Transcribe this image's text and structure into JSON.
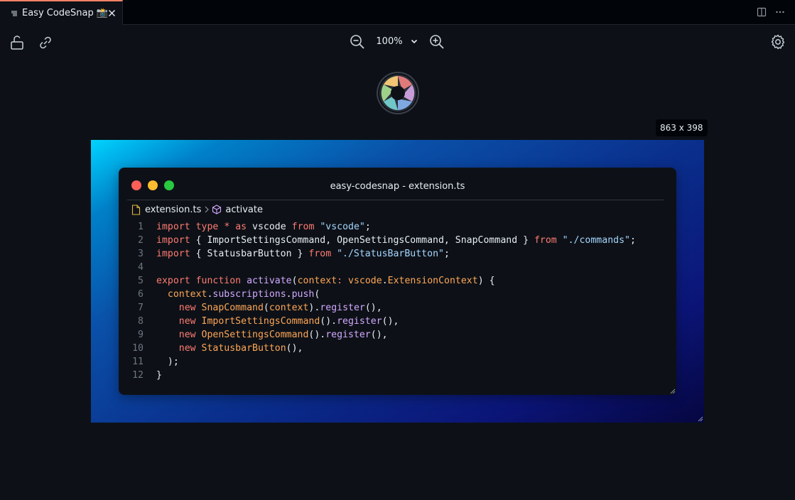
{
  "tab": {
    "label": "Easy CodeSnap 📸",
    "icon": "preview-list-icon",
    "close_icon": "close-icon"
  },
  "tabbar_actions": [
    "split-editor-icon",
    "more-actions-icon"
  ],
  "toolbar": {
    "lock_icon": "unlock-icon",
    "link_icon": "link-icon",
    "zoom_out_icon": "zoom-out-icon",
    "zoom_value": "100%",
    "zoom_in_icon": "zoom-in-icon",
    "settings_icon": "gear-icon"
  },
  "logo": {
    "icon": "camera-shutter-logo"
  },
  "size_badge": "863 x 398",
  "snapshot": {
    "window_title": "easy-codesnap - extension.ts",
    "breadcrumb": {
      "file": "extension.ts",
      "symbol": "activate"
    },
    "traffic_lights": [
      "#ff5f57",
      "#febc2e",
      "#28c840"
    ],
    "code_lines": [
      {
        "n": "1",
        "tokens": [
          [
            "kw",
            "import"
          ],
          [
            "plain",
            " "
          ],
          [
            "kw",
            "type"
          ],
          [
            "plain",
            " "
          ],
          [
            "kw",
            "*"
          ],
          [
            "plain",
            " "
          ],
          [
            "kw",
            "as"
          ],
          [
            "plain",
            " vscode "
          ],
          [
            "kw",
            "from"
          ],
          [
            "plain",
            " "
          ],
          [
            "str",
            "\"vscode\""
          ],
          [
            "punc",
            ";"
          ]
        ]
      },
      {
        "n": "2",
        "tokens": [
          [
            "kw",
            "import"
          ],
          [
            "plain",
            " { ImportSettingsCommand, OpenSettingsCommand, SnapCommand } "
          ],
          [
            "kw",
            "from"
          ],
          [
            "plain",
            " "
          ],
          [
            "str",
            "\"./commands\""
          ],
          [
            "punc",
            ";"
          ]
        ]
      },
      {
        "n": "3",
        "tokens": [
          [
            "kw",
            "import"
          ],
          [
            "plain",
            " { StatusbarButton } "
          ],
          [
            "kw",
            "from"
          ],
          [
            "plain",
            " "
          ],
          [
            "str",
            "\"./StatusBarButton\""
          ],
          [
            "punc",
            ";"
          ]
        ]
      },
      {
        "n": "4",
        "tokens": []
      },
      {
        "n": "5",
        "tokens": [
          [
            "kw",
            "export"
          ],
          [
            "plain",
            " "
          ],
          [
            "kw",
            "function"
          ],
          [
            "plain",
            " "
          ],
          [
            "fn",
            "activate"
          ],
          [
            "punc",
            "("
          ],
          [
            "var",
            "context"
          ],
          [
            "kw",
            ":"
          ],
          [
            "plain",
            " "
          ],
          [
            "cls",
            "vscode"
          ],
          [
            "punc",
            "."
          ],
          [
            "cls",
            "ExtensionContext"
          ],
          [
            "punc",
            ") {"
          ]
        ]
      },
      {
        "n": "6",
        "tokens": [
          [
            "plain",
            "  "
          ],
          [
            "var",
            "context"
          ],
          [
            "punc",
            "."
          ],
          [
            "prop",
            "subscriptions"
          ],
          [
            "punc",
            "."
          ],
          [
            "fn",
            "push"
          ],
          [
            "punc",
            "("
          ]
        ]
      },
      {
        "n": "7",
        "tokens": [
          [
            "plain",
            "    "
          ],
          [
            "kw",
            "new"
          ],
          [
            "plain",
            " "
          ],
          [
            "cls",
            "SnapCommand"
          ],
          [
            "punc",
            "("
          ],
          [
            "var",
            "context"
          ],
          [
            "punc",
            ")."
          ],
          [
            "fn",
            "register"
          ],
          [
            "punc",
            "(),"
          ]
        ]
      },
      {
        "n": "8",
        "tokens": [
          [
            "plain",
            "    "
          ],
          [
            "kw",
            "new"
          ],
          [
            "plain",
            " "
          ],
          [
            "cls",
            "ImportSettingsCommand"
          ],
          [
            "punc",
            "()."
          ],
          [
            "fn",
            "register"
          ],
          [
            "punc",
            "(),"
          ]
        ]
      },
      {
        "n": "9",
        "tokens": [
          [
            "plain",
            "    "
          ],
          [
            "kw",
            "new"
          ],
          [
            "plain",
            " "
          ],
          [
            "cls",
            "OpenSettingsCommand"
          ],
          [
            "punc",
            "()."
          ],
          [
            "fn",
            "register"
          ],
          [
            "punc",
            "(),"
          ]
        ]
      },
      {
        "n": "10",
        "tokens": [
          [
            "plain",
            "    "
          ],
          [
            "kw",
            "new"
          ],
          [
            "plain",
            " "
          ],
          [
            "cls",
            "StatusbarButton"
          ],
          [
            "punc",
            "(),"
          ]
        ]
      },
      {
        "n": "11",
        "tokens": [
          [
            "plain",
            "  "
          ],
          [
            "punc",
            ");"
          ]
        ]
      },
      {
        "n": "12",
        "tokens": [
          [
            "punc",
            "}"
          ]
        ]
      }
    ]
  },
  "colors": {
    "editor_bg": "#0d1117",
    "tabbar_bg": "#010409",
    "tab_accent": "#f78166",
    "keyword": "#ff7b72",
    "string": "#a5d6ff",
    "function": "#d2a8ff",
    "class": "#ffa657",
    "gradient_start": "#00d4ff",
    "gradient_end": "#060640"
  }
}
